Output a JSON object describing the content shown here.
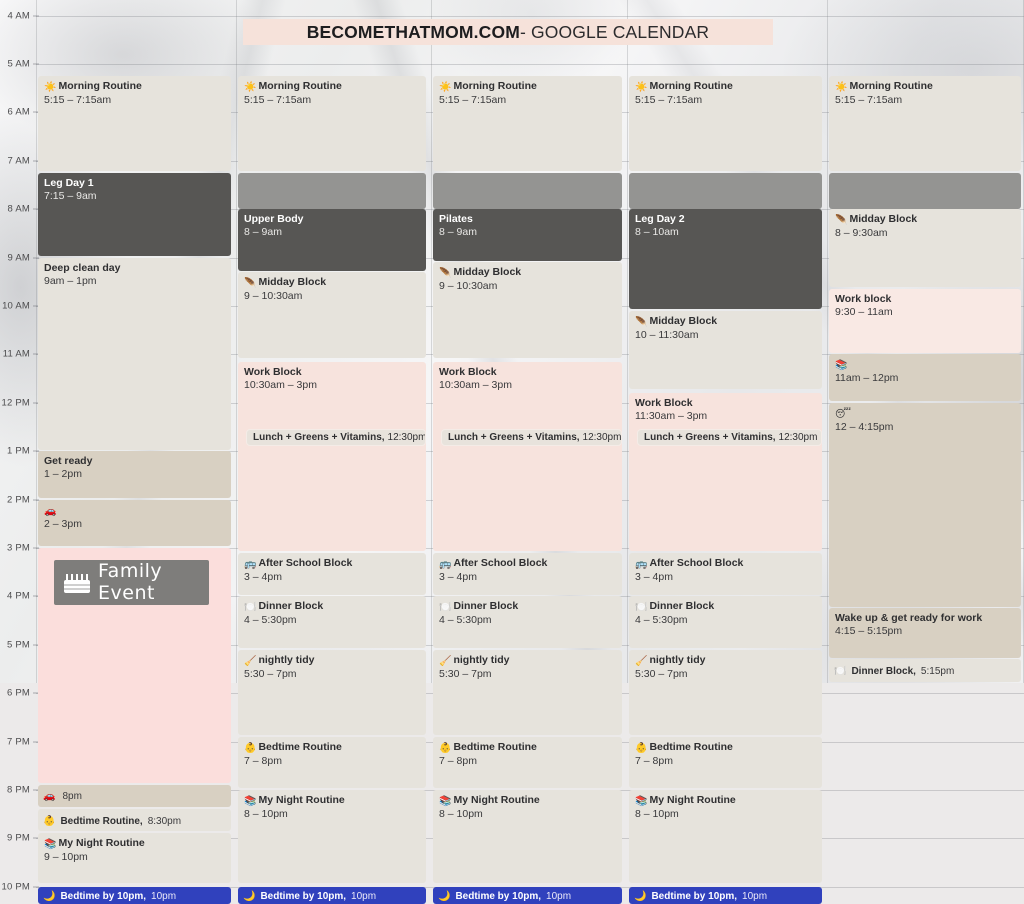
{
  "header": {
    "title_bold": "BECOMETHATMOM.COM",
    "title_rest": " - GOOGLE CALENDAR",
    "band_color": "#f6e2da"
  },
  "time_axis": {
    "labels": [
      "4 AM",
      "5 AM",
      "6 AM",
      "7 AM",
      "8 AM",
      "9 AM",
      "10 AM",
      "11 AM",
      "12 PM",
      "1 PM",
      "2 PM",
      "3 PM",
      "4 PM",
      "5 PM",
      "6 PM",
      "7 PM",
      "8 PM",
      "9 PM",
      "10 PM"
    ]
  },
  "colors": {
    "beige": "#e6e3dc",
    "beige_dark": "#d8d0c2",
    "pink": "#f7e3dd",
    "pink_light": "#f9e9e4",
    "graphite": "#575654",
    "mid_gray": "#949492",
    "bedtime_blue": "#3041bd",
    "family_pink": "#fbdedc",
    "family_label_gray": "#7e7d7b"
  },
  "columns": [
    {
      "name": "day-1",
      "events": [
        {
          "title": "Morning Routine",
          "time": "5:15 – 7:15am",
          "icon": "sun-emoji",
          "style": "beige"
        },
        {
          "title": "Leg Day 1",
          "time": "7:15 – 9am",
          "icon": "",
          "style": "dark"
        },
        {
          "title": "Deep clean day",
          "time": "9am – 1pm",
          "icon": "",
          "style": "beige"
        },
        {
          "title": "Get ready",
          "time": "1 – 2pm",
          "icon": "",
          "style": "beige2"
        },
        {
          "title": "",
          "time": "2 – 3pm",
          "icon": "car-emoji",
          "style": "beige2"
        },
        {
          "title": "Family Event",
          "time": "",
          "icon": "cake-icon",
          "style": "family"
        },
        {
          "title": "",
          "time": "8pm",
          "icon": "car-emoji",
          "style": "beige2-chip"
        },
        {
          "title": "Bedtime Routine,",
          "time": "8:30pm",
          "icon": "baby-emoji",
          "style": "beige-chip"
        },
        {
          "title": "My Night Routine",
          "time": "9 – 10pm",
          "icon": "books-candle-emoji",
          "style": "beige"
        },
        {
          "title": "Bedtime by 10pm,",
          "time": "10pm",
          "icon": "moon-emoji",
          "style": "blue"
        }
      ]
    },
    {
      "name": "day-2",
      "events": [
        {
          "title": "Morning Routine",
          "time": "5:15 – 7:15am",
          "icon": "sun-emoji",
          "style": "beige"
        },
        {
          "title": "",
          "time": "",
          "icon": "",
          "style": "midgray"
        },
        {
          "title": "Upper Body",
          "time": "8 – 9am",
          "icon": "",
          "style": "dark"
        },
        {
          "title": "Midday Block",
          "time": "9 – 10:30am",
          "icon": "feather-emoji",
          "style": "beige"
        },
        {
          "title": "Work Block",
          "time": "10:30am – 3pm",
          "icon": "",
          "style": "pink"
        },
        {
          "title": "Lunch + Greens + Vitamins,",
          "time": "12:30pm",
          "icon": "",
          "style": "lunch-pill"
        },
        {
          "title": "After School Block",
          "time": "3 – 4pm",
          "icon": "bus-emoji",
          "style": "beige"
        },
        {
          "title": "Dinner Block",
          "time": "4 – 5:30pm",
          "icon": "plate-emoji",
          "style": "beige"
        },
        {
          "title": "nightly tidy",
          "time": "5:30 – 7pm",
          "icon": "broom-emoji",
          "style": "beige"
        },
        {
          "title": "Bedtime Routine",
          "time": "7 – 8pm",
          "icon": "baby-emoji",
          "style": "beige"
        },
        {
          "title": "My Night Routine",
          "time": "8 – 10pm",
          "icon": "books-candle-emoji",
          "style": "beige"
        },
        {
          "title": "Bedtime by 10pm,",
          "time": "10pm",
          "icon": "moon-emoji",
          "style": "blue"
        }
      ]
    },
    {
      "name": "day-3",
      "events": [
        {
          "title": "Morning Routine",
          "time": "5:15 – 7:15am",
          "icon": "sun-emoji",
          "style": "beige"
        },
        {
          "title": "",
          "time": "",
          "icon": "",
          "style": "midgray"
        },
        {
          "title": "Pilates",
          "time": "8 – 9am",
          "icon": "",
          "style": "dark"
        },
        {
          "title": "Midday Block",
          "time": "9 – 10:30am",
          "icon": "feather-emoji",
          "style": "beige"
        },
        {
          "title": "Work Block",
          "time": "10:30am – 3pm",
          "icon": "",
          "style": "pink"
        },
        {
          "title": "Lunch + Greens + Vitamins,",
          "time": "12:30pm",
          "icon": "",
          "style": "lunch-pill"
        },
        {
          "title": "After School Block",
          "time": "3 – 4pm",
          "icon": "bus-emoji",
          "style": "beige"
        },
        {
          "title": "Dinner Block",
          "time": "4 – 5:30pm",
          "icon": "plate-emoji",
          "style": "beige"
        },
        {
          "title": "nightly tidy",
          "time": "5:30 – 7pm",
          "icon": "broom-emoji",
          "style": "beige"
        },
        {
          "title": "Bedtime Routine",
          "time": "7 – 8pm",
          "icon": "baby-emoji",
          "style": "beige"
        },
        {
          "title": "My Night Routine",
          "time": "8 – 10pm",
          "icon": "books-candle-emoji",
          "style": "beige"
        },
        {
          "title": "Bedtime by 10pm,",
          "time": "10pm",
          "icon": "moon-emoji",
          "style": "blue"
        }
      ]
    },
    {
      "name": "day-4",
      "events": [
        {
          "title": "Morning Routine",
          "time": "5:15 – 7:15am",
          "icon": "sun-emoji",
          "style": "beige"
        },
        {
          "title": "",
          "time": "",
          "icon": "",
          "style": "midgray"
        },
        {
          "title": "Leg Day 2",
          "time": "8 – 10am",
          "icon": "",
          "style": "dark"
        },
        {
          "title": "Midday Block",
          "time": "10 – 11:30am",
          "icon": "feather-emoji",
          "style": "beige"
        },
        {
          "title": "Work Block",
          "time": "11:30am – 3pm",
          "icon": "",
          "style": "pink"
        },
        {
          "title": "Lunch + Greens + Vitamins,",
          "time": "12:30pm",
          "icon": "",
          "style": "lunch-pill"
        },
        {
          "title": "After School Block",
          "time": "3 – 4pm",
          "icon": "bus-emoji",
          "style": "beige"
        },
        {
          "title": "Dinner Block",
          "time": "4 – 5:30pm",
          "icon": "plate-emoji",
          "style": "beige"
        },
        {
          "title": "nightly tidy",
          "time": "5:30 – 7pm",
          "icon": "broom-emoji",
          "style": "beige"
        },
        {
          "title": "Bedtime Routine",
          "time": "7 – 8pm",
          "icon": "baby-emoji",
          "style": "beige"
        },
        {
          "title": "My Night Routine",
          "time": "8 – 10pm",
          "icon": "books-candle-emoji",
          "style": "beige"
        },
        {
          "title": "Bedtime by 10pm,",
          "time": "10pm",
          "icon": "moon-emoji",
          "style": "blue"
        }
      ]
    },
    {
      "name": "day-5",
      "events": [
        {
          "title": "Morning Routine",
          "time": "5:15 – 7:15am",
          "icon": "sun-emoji",
          "style": "beige"
        },
        {
          "title": "",
          "time": "",
          "icon": "",
          "style": "midgray"
        },
        {
          "title": "Midday Block",
          "time": "8 – 9:30am",
          "icon": "feather-emoji",
          "style": "beige"
        },
        {
          "title": "Work block",
          "time": "9:30 – 11am",
          "icon": "",
          "style": "pinklight"
        },
        {
          "title": "",
          "time": "11am – 12pm",
          "icon": "books-emoji",
          "style": "beige2"
        },
        {
          "title": "",
          "time": "12 – 4:15pm",
          "icon": "sleepy-emoji",
          "style": "beige2"
        },
        {
          "title": "Wake up & get ready for work",
          "time": "4:15 – 5:15pm",
          "icon": "",
          "style": "beige2"
        },
        {
          "title": "Dinner Block,",
          "time": "5:15pm",
          "icon": "plate-emoji",
          "style": "beige-chip"
        }
      ]
    }
  ]
}
